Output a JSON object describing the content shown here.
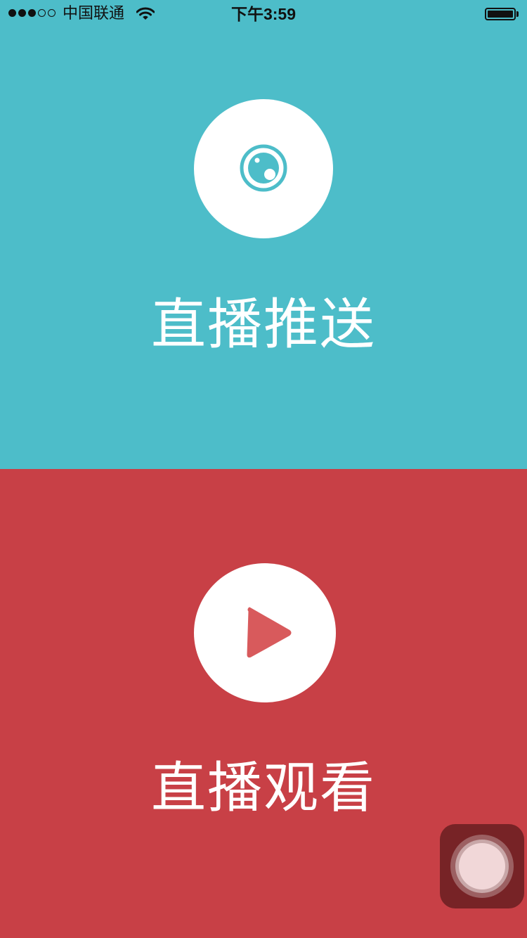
{
  "status_bar": {
    "signal_filled": 3,
    "signal_total": 5,
    "carrier": "中国联通",
    "time": "下午3:59",
    "battery_level": 1.0
  },
  "panels": {
    "push": {
      "title": "直播推送",
      "icon": "camera-lens-icon",
      "background": "#4dbdc9"
    },
    "watch": {
      "title": "直播观看",
      "icon": "play-icon",
      "background": "#c84046"
    }
  },
  "assistive_touch": {
    "icon": "assistive-touch-icon"
  }
}
